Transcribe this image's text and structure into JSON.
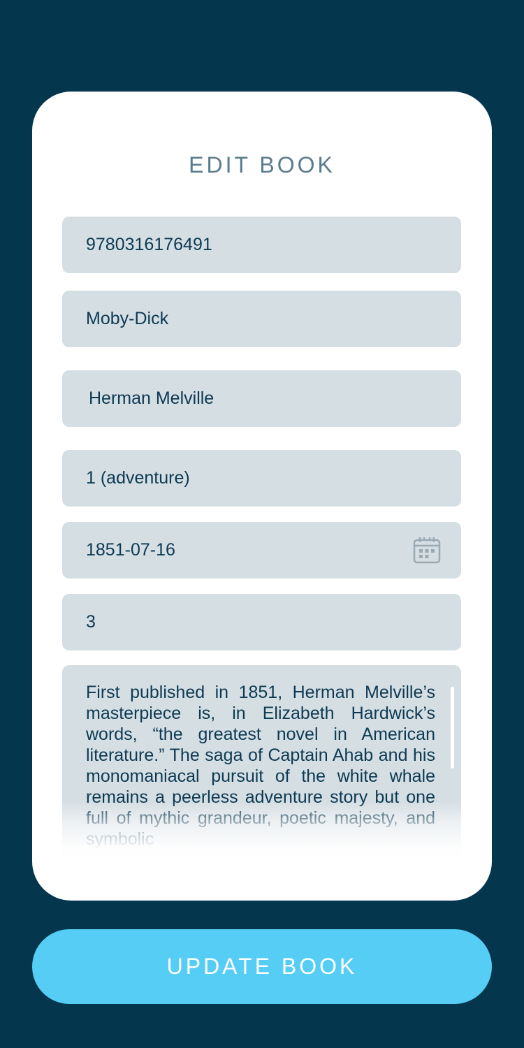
{
  "screen": {
    "title": "EDIT BOOK",
    "colors": {
      "background": "#04364e",
      "card": "#ffffff",
      "field": "#d5dee3",
      "text": "#0d3a52",
      "title": "#5a7b8e",
      "accent": "#56cdf5"
    }
  },
  "form": {
    "isbn": "9780316176491",
    "book_title": "Moby-Dick",
    "author": "Herman Melville",
    "category": "1 (adventure)",
    "published_date": "1851-07-16",
    "quantity": "3",
    "description": "First published in 1851, Herman Mel­ville’s masterpiece is, in Elizabeth Hard­wick’s words, “the greatest novel in American literature.” The saga of Cap­tain Ahab and his monomaniacal pursuit of the white whale remains a peerless adventure story but one full of mythic grandeur, poetic majesty, and symbolic",
    "date_icon": "calendar-icon"
  },
  "actions": {
    "update_label": "UPDATE BOOK"
  }
}
